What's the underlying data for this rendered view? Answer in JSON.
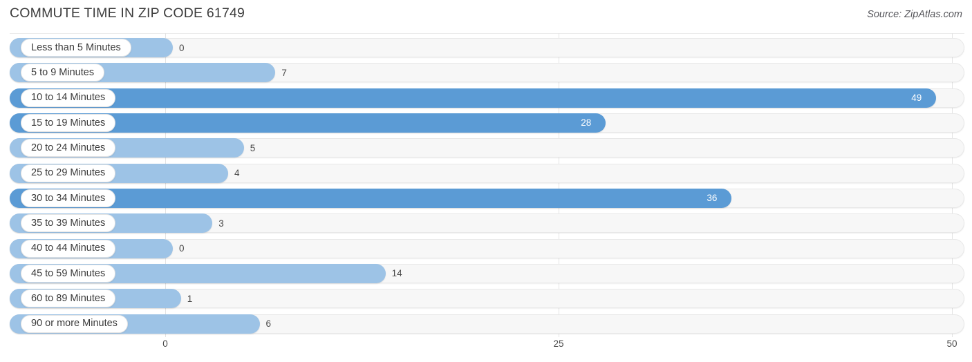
{
  "header": {
    "title": "COMMUTE TIME IN ZIP CODE 61749",
    "source": "Source: ZipAtlas.com"
  },
  "chart_data": {
    "type": "bar",
    "orientation": "horizontal",
    "title": "COMMUTE TIME IN ZIP CODE 61749",
    "xlabel": "",
    "ylabel": "",
    "xlim": [
      0,
      50
    ],
    "xticks": [
      "0",
      "25",
      "50"
    ],
    "xtick_values": [
      0,
      25,
      50
    ],
    "grid": true,
    "legend": false,
    "categories": [
      "Less than 5 Minutes",
      "5 to 9 Minutes",
      "10 to 14 Minutes",
      "15 to 19 Minutes",
      "20 to 24 Minutes",
      "25 to 29 Minutes",
      "30 to 34 Minutes",
      "35 to 39 Minutes",
      "40 to 44 Minutes",
      "45 to 59 Minutes",
      "60 to 89 Minutes",
      "90 or more Minutes"
    ],
    "values": [
      0,
      7,
      49,
      28,
      5,
      4,
      36,
      3,
      0,
      14,
      1,
      6
    ],
    "value_labels": [
      "0",
      "7",
      "49",
      "28",
      "5",
      "4",
      "36",
      "3",
      "0",
      "14",
      "1",
      "6"
    ],
    "colors": {
      "bar_light": "#9dc3e6",
      "bar_dark": "#5b9bd5",
      "track": "#f7f7f7",
      "gridline": "#e3e3e3",
      "title_text": "#3c3c3c",
      "value_text": "#4a4a4a",
      "value_text_inside": "#ffffff"
    }
  }
}
